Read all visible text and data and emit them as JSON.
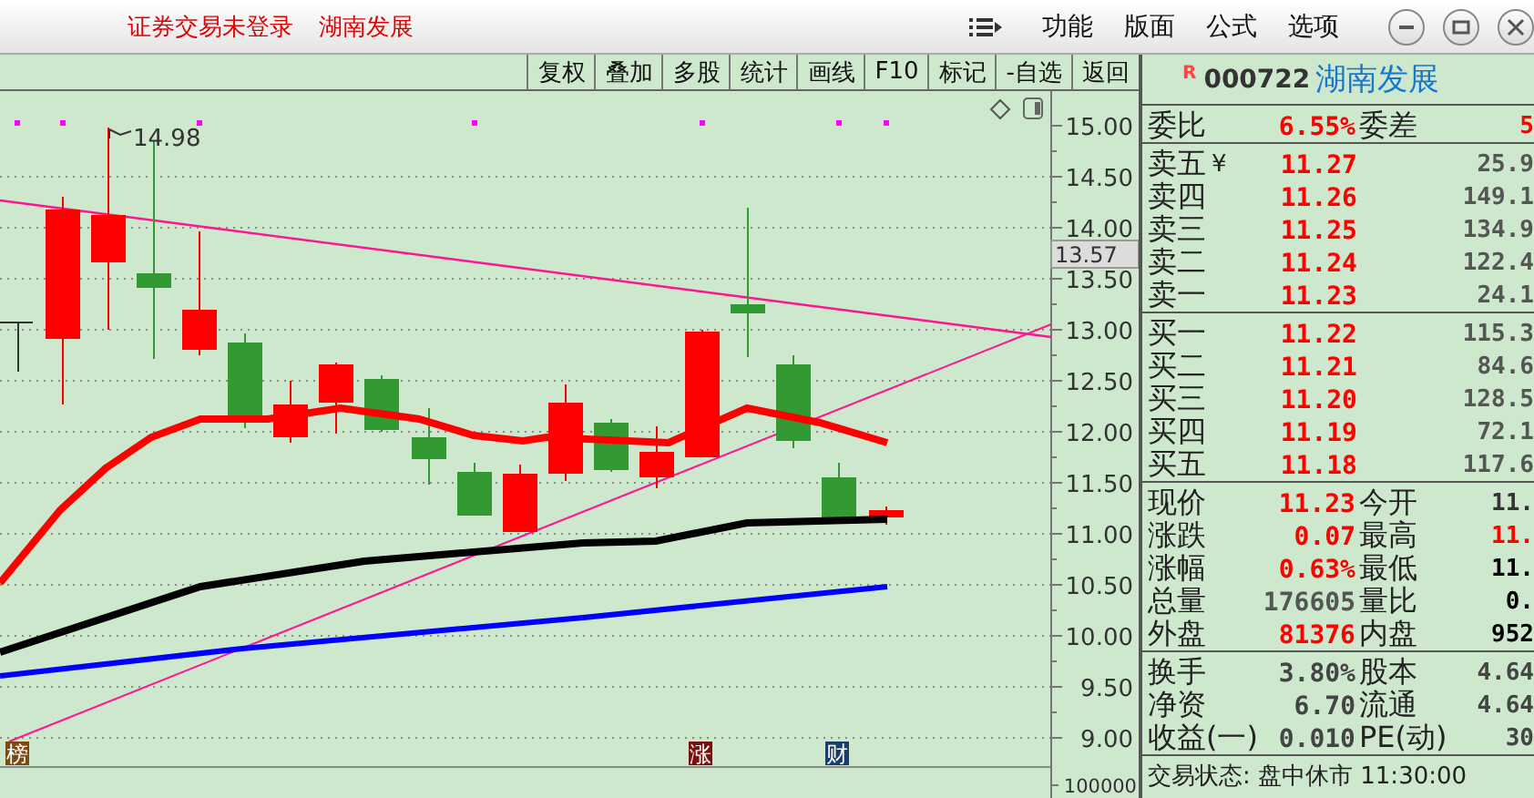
{
  "title_bar": {
    "login_status": "证券交易未登录",
    "stock_name": "湖南发展",
    "menus": [
      "功能",
      "版面",
      "公式",
      "选项"
    ]
  },
  "toolbar": {
    "buttons": [
      "复权",
      "叠加",
      "多股",
      "统计",
      "画线",
      "F10",
      "标记",
      "-自选",
      "返回"
    ]
  },
  "chart": {
    "price_labels": [
      "15.00",
      "14.50",
      "14.00",
      "13.50",
      "13.00",
      "12.50",
      "12.00",
      "11.50",
      "11.00",
      "10.50",
      "10.00",
      "9.50",
      "9.00"
    ],
    "current_price_label": "13.57",
    "high_label": "14.98",
    "volume_label": "100000",
    "markers": [
      {
        "text": "榜",
        "color": "#7a4a10"
      },
      {
        "text": "涨",
        "color": "#7a1010"
      },
      {
        "text": "财",
        "color": "#1a3d6e"
      }
    ]
  },
  "quote": {
    "flag": "R",
    "code": "000722",
    "name": "湖南发展",
    "ratio": [
      {
        "label": "委比",
        "value": "6.55%",
        "color": "#ff0000"
      },
      {
        "label": "委差",
        "value": "5",
        "color": "#ff0000"
      }
    ],
    "asks": [
      {
        "label": "卖五",
        "symbol": "¥",
        "price": "11.27",
        "volume": "25.9"
      },
      {
        "label": "卖四",
        "price": "11.26",
        "volume": "149.1"
      },
      {
        "label": "卖三",
        "price": "11.25",
        "volume": "134.9"
      },
      {
        "label": "卖二",
        "price": "11.24",
        "volume": "122.4"
      },
      {
        "label": "卖一",
        "price": "11.23",
        "volume": "24.1"
      }
    ],
    "bids": [
      {
        "label": "买一",
        "price": "11.22",
        "volume": "115.3"
      },
      {
        "label": "买二",
        "price": "11.21",
        "volume": "84.6"
      },
      {
        "label": "买三",
        "price": "11.20",
        "volume": "128.5"
      },
      {
        "label": "买四",
        "price": "11.19",
        "volume": "72.1"
      },
      {
        "label": "买五",
        "price": "11.18",
        "volume": "117.6"
      }
    ],
    "stats": [
      [
        {
          "label": "现价",
          "value": "11.23",
          "color": "#ff0000"
        },
        {
          "label": "今开",
          "value": "11.",
          "color": "#333333"
        }
      ],
      [
        {
          "label": "涨跌",
          "value": "0.07",
          "color": "#ff0000"
        },
        {
          "label": "最高",
          "value": "11.",
          "color": "#ff0000"
        }
      ],
      [
        {
          "label": "涨幅",
          "value": "0.63%",
          "color": "#ff0000"
        },
        {
          "label": "最低",
          "value": "11.",
          "color": "#000000"
        }
      ],
      [
        {
          "label": "总量",
          "value": "176605",
          "color": "#555555"
        },
        {
          "label": "量比",
          "value": "0.",
          "color": "#000000"
        }
      ],
      [
        {
          "label": "外盘",
          "value": "81376",
          "color": "#ff0000"
        },
        {
          "label": "内盘",
          "value": "952",
          "color": "#000000"
        }
      ]
    ],
    "fundamentals": [
      [
        {
          "label": "换手",
          "value": "3.80%",
          "color": "#444444"
        },
        {
          "label": "股本",
          "value": "4.64",
          "color": "#444444"
        }
      ],
      [
        {
          "label": "净资",
          "value": "6.70",
          "color": "#444444"
        },
        {
          "label": "流通",
          "value": "4.64",
          "color": "#444444"
        }
      ],
      [
        {
          "label": "收益(一)",
          "value": "0.010",
          "color": "#444444"
        },
        {
          "label": "PE(动)",
          "value": "30",
          "color": "#444444"
        }
      ]
    ],
    "status": "交易状态: 盘中休市 11:30:00"
  }
}
